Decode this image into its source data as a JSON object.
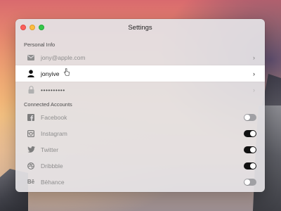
{
  "window": {
    "title": "Settings"
  },
  "sections": {
    "personal": {
      "header": "Personal Info",
      "rows": [
        {
          "icon": "envelope-icon",
          "label": "jony@apple.com"
        },
        {
          "icon": "user-icon",
          "label": "jonyive",
          "selected": true
        },
        {
          "icon": "lock-icon",
          "label": "••••••••••"
        }
      ]
    },
    "accounts": {
      "header": "Connected Accounts",
      "rows": [
        {
          "icon": "facebook-icon",
          "label": "Facebook",
          "enabled": false
        },
        {
          "icon": "instagram-icon",
          "label": "Instagram",
          "enabled": true
        },
        {
          "icon": "twitter-icon",
          "label": "Twitter",
          "enabled": true
        },
        {
          "icon": "dribbble-icon",
          "label": "Dribbble",
          "enabled": true
        },
        {
          "icon": "behance-icon",
          "label": "Bēhance",
          "enabled": false
        }
      ]
    }
  },
  "colors": {
    "toggle_on": "#111111",
    "toggle_off": "#a0a0a4",
    "selected_row": "#ffffff"
  }
}
